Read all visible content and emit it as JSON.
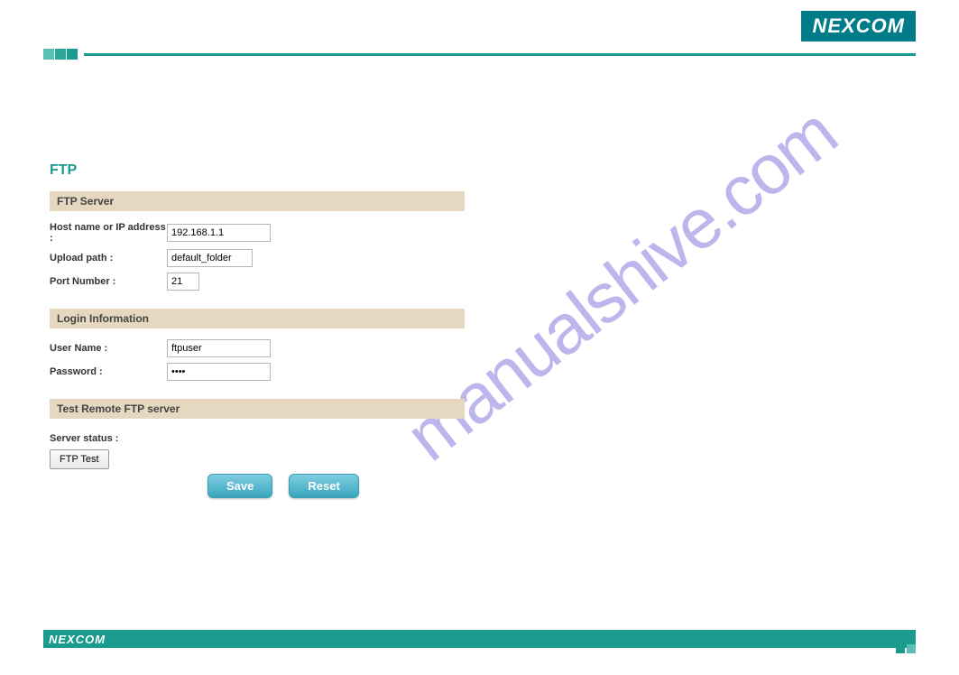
{
  "branding": {
    "logo_text": "NEXCOM",
    "footer_logo_text": "NEXCOM"
  },
  "watermark": "manualshive.com",
  "page": {
    "title": "FTP"
  },
  "sections": {
    "ftp_server": {
      "heading": "FTP Server",
      "host_label": "Host name or IP address :",
      "host_value": "192.168.1.1",
      "upload_label": "Upload path :",
      "upload_value": "default_folder",
      "port_label": "Port Number :",
      "port_value": "21"
    },
    "login": {
      "heading": "Login Information",
      "user_label": "User Name :",
      "user_value": "ftpuser",
      "pass_label": "Password :",
      "pass_value": "••••"
    },
    "test": {
      "heading": "Test Remote FTP server",
      "status_label": "Server status :",
      "test_button": "FTP Test"
    }
  },
  "actions": {
    "save": "Save",
    "reset": "Reset"
  }
}
